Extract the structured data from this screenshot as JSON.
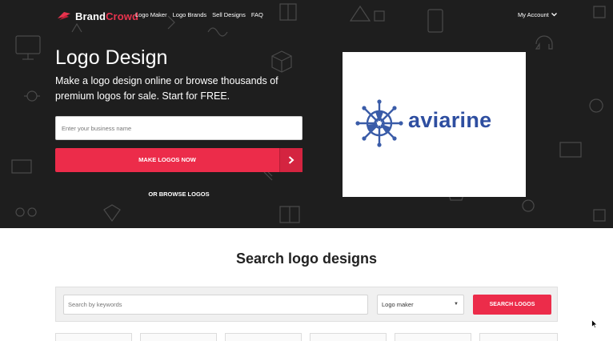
{
  "nav": {
    "brand_part1": "Brand",
    "brand_part2": "Crowd",
    "links": [
      "Logo Maker",
      "Logo Brands",
      "Sell Designs",
      "FAQ"
    ],
    "account": "My Account"
  },
  "hero": {
    "title": "Logo Design",
    "subtitle": "Make a logo design online or browse thousands of premium logos for sale. Start for FREE.",
    "business_placeholder": "Enter your business name",
    "business_value": "",
    "make_button": "MAKE LOGOS NOW",
    "browse_link": "OR BROWSE LOGOS"
  },
  "preview": {
    "brand_name": "aviarine",
    "icon": "ship-wheel-propeller-icon"
  },
  "search": {
    "title": "Search logo designs",
    "keyword_placeholder": "Search by keywords",
    "keyword_value": "",
    "type_selected": "Logo maker",
    "button": "SEARCH LOGOS"
  },
  "colors": {
    "hero_bg": "#1e1e1e",
    "accent": "#ec2c4a",
    "brand_blue": "#2e4ea0",
    "mark_blue": "#3a5ca8"
  },
  "icons": [
    "brand-logo-icon",
    "chevron-down-icon",
    "arrow-right-icon",
    "mouse-cursor-icon"
  ]
}
